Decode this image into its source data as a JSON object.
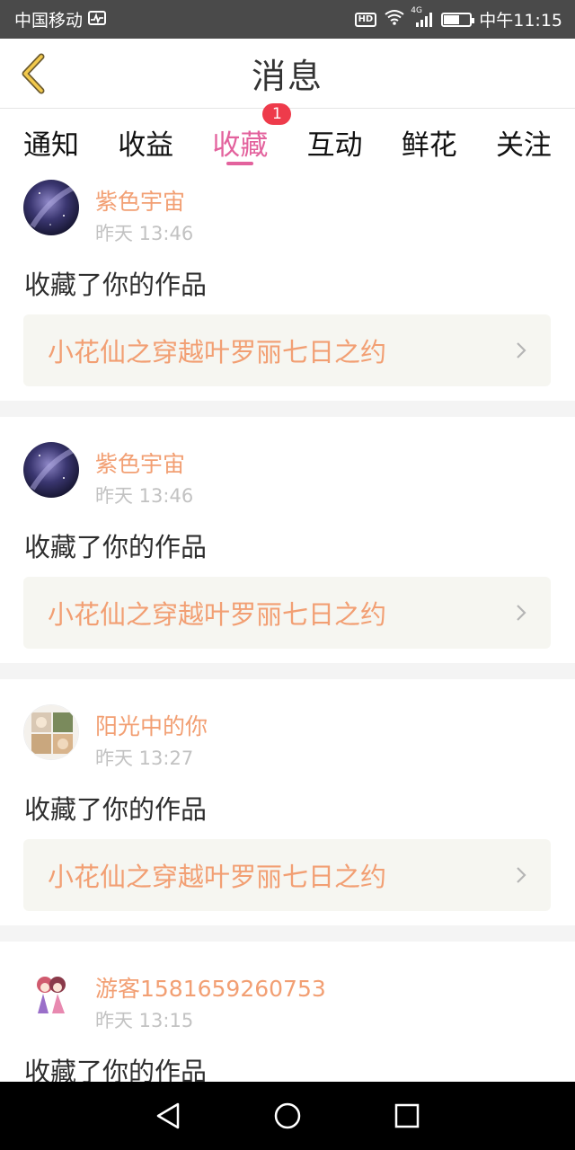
{
  "status_bar": {
    "carrier": "中国移动",
    "hd": "HD",
    "network": "4G",
    "battery_level": 0.55,
    "time": "中午11:15"
  },
  "header": {
    "title": "消息",
    "back_icon": "chevron-left-icon"
  },
  "tabs": [
    {
      "label": "通知"
    },
    {
      "label": "收益"
    },
    {
      "label": "收藏",
      "active": true,
      "badge": "1"
    },
    {
      "label": "互动"
    },
    {
      "label": "鲜花"
    },
    {
      "label": "关注"
    }
  ],
  "messages": [
    {
      "user": "紫色宇宙",
      "time": "昨天 13:46",
      "action": "收藏了你的作品",
      "work": "小花仙之穿越叶罗丽七日之约",
      "avatar": "galaxy"
    },
    {
      "user": "紫色宇宙",
      "time": "昨天 13:46",
      "action": "收藏了你的作品",
      "work": "小花仙之穿越叶罗丽七日之约",
      "avatar": "galaxy"
    },
    {
      "user": "阳光中的你",
      "time": "昨天 13:27",
      "action": "收藏了你的作品",
      "work": "小花仙之穿越叶罗丽七日之约",
      "avatar": "photo-grid"
    },
    {
      "user": "游客1581659260753",
      "time": "昨天 13:15",
      "action": "收藏了你的作品",
      "work": "",
      "avatar": "anime-girls"
    }
  ],
  "colors": {
    "accent": "#e3629d",
    "username": "#f29f73",
    "badge": "#ee3b4b",
    "work_box_bg": "#f6f6f1"
  },
  "nav": {
    "back_icon": "triangle-back-icon",
    "home_icon": "circle-home-icon",
    "recents_icon": "square-recents-icon"
  }
}
